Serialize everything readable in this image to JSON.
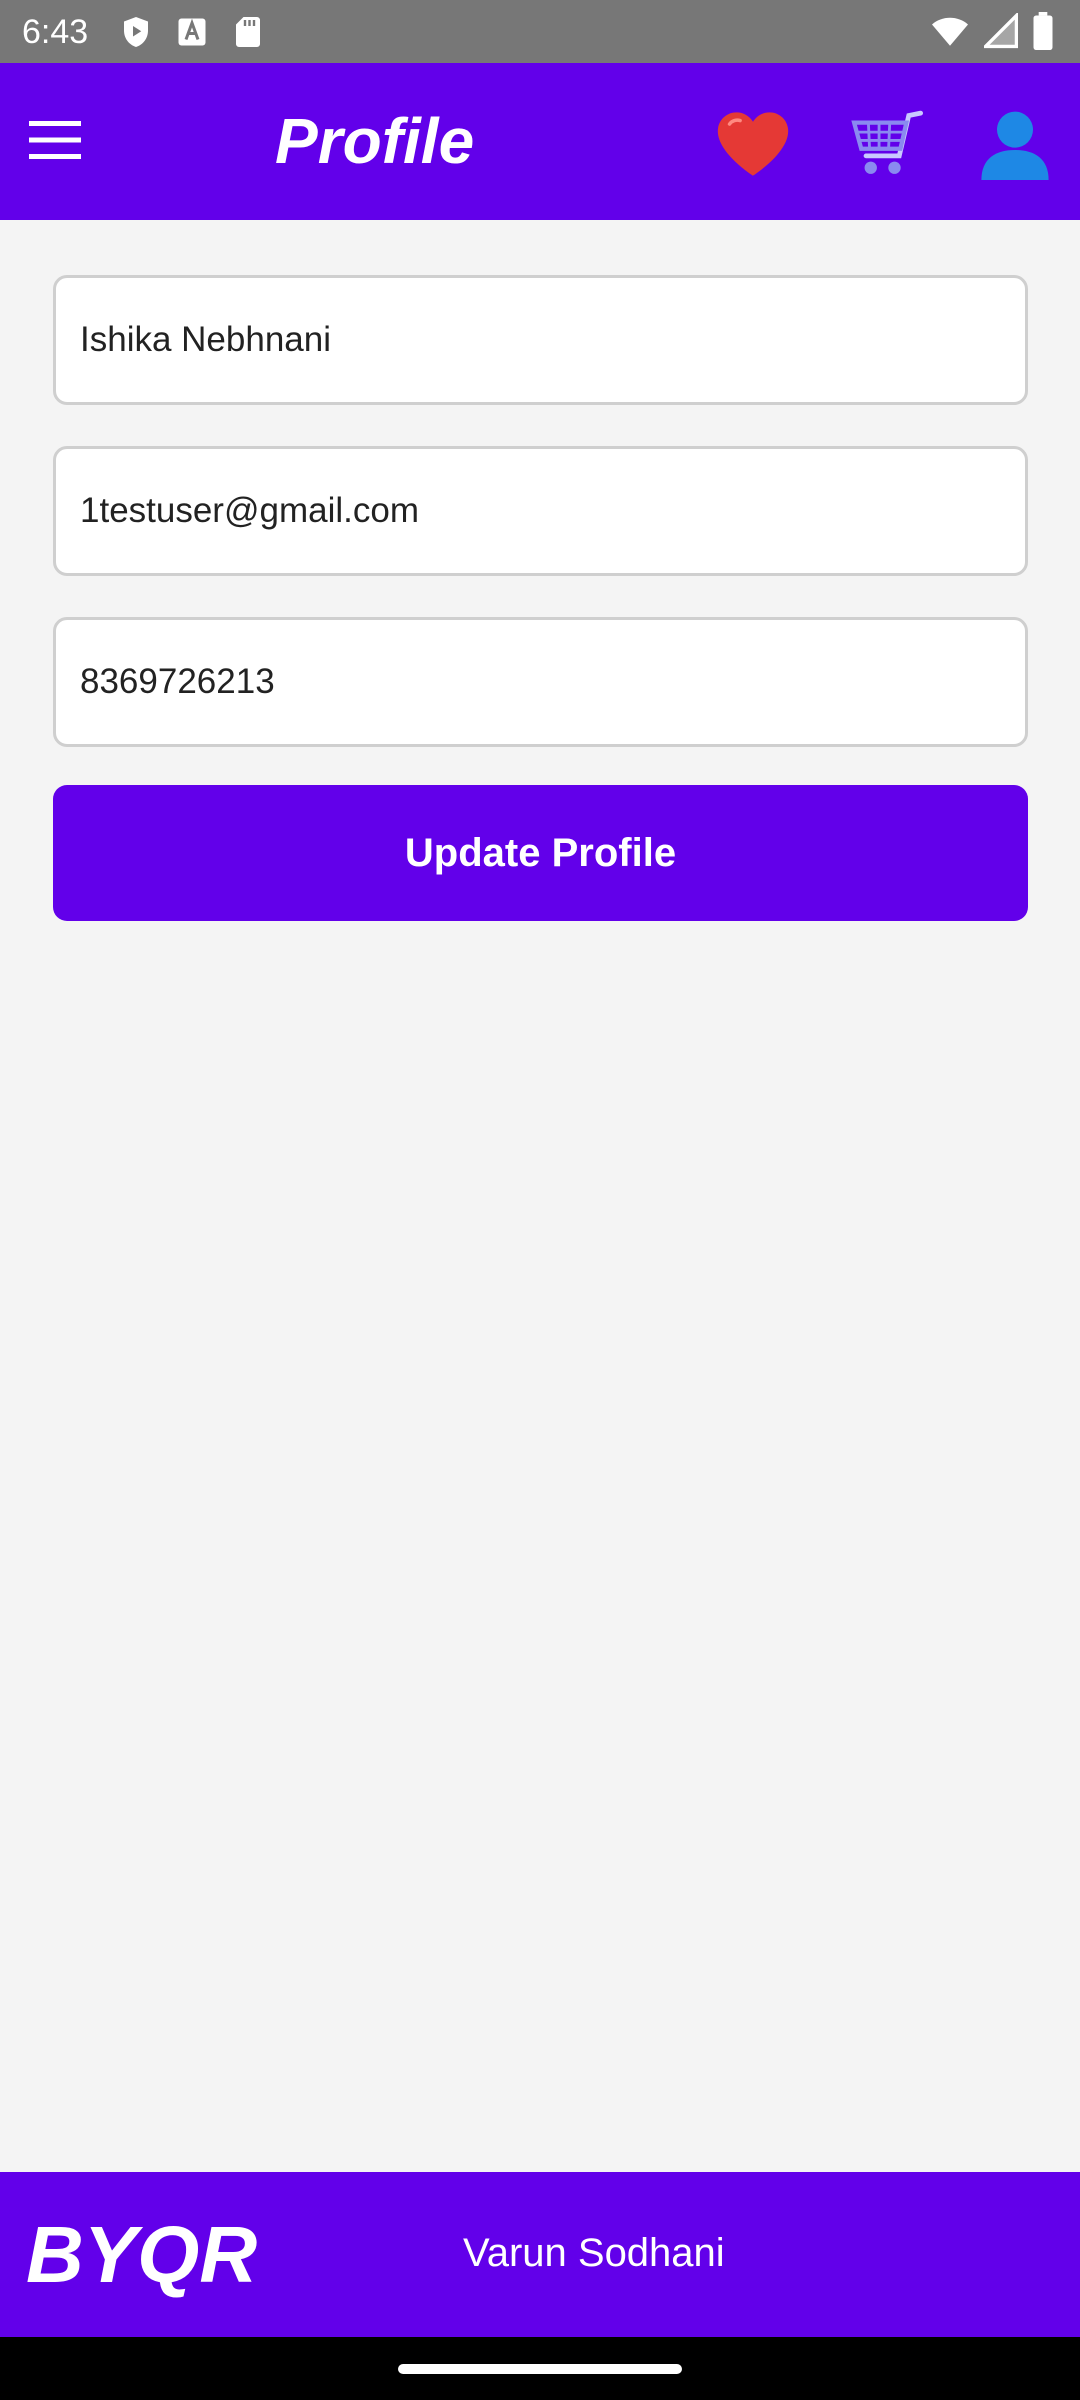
{
  "status_bar": {
    "time": "6:43",
    "left_icons": [
      "shield-play-icon",
      "font-a-icon",
      "sd-card-icon"
    ],
    "right_icons": [
      "wifi-icon",
      "signal-icon",
      "battery-icon"
    ]
  },
  "app_bar": {
    "title": "Profile",
    "background": "#6200ea",
    "actions": [
      "heart-icon",
      "cart-icon",
      "account-icon"
    ]
  },
  "form": {
    "name_value": "Ishika Nebhnani",
    "email_value": "1testuser@gmail.com",
    "phone_value": "8369726213",
    "update_label": "Update Profile"
  },
  "footer": {
    "brand": "BYQR",
    "author": "Varun Sodhani"
  },
  "colors": {
    "accent": "#6200ea",
    "page_background": "#f4f4f4",
    "status_bar": "#777777",
    "favorite_heart": "#e53935",
    "cart": "#8a8af0",
    "account": "#1e88e5"
  }
}
